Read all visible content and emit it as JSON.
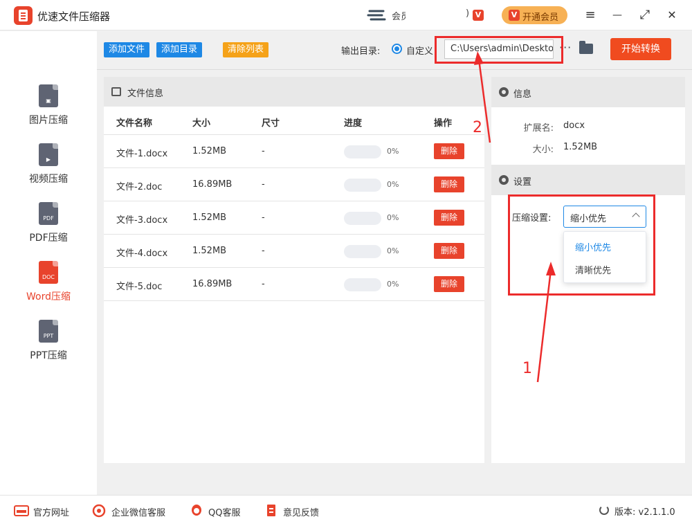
{
  "app": {
    "title": "优速文件压缩器",
    "center_text": "会员",
    "vip_label": "开通会员",
    "vip_badge": "V",
    "paren": ")"
  },
  "window_controls": {
    "menu": "≡",
    "minimize": "—",
    "maximize": "⤢",
    "close": "✕"
  },
  "sidebar": {
    "items": [
      {
        "label": "图片压缩",
        "glyph": "",
        "icon": "image-file-icon"
      },
      {
        "label": "视频压缩",
        "glyph": "▶",
        "icon": "video-file-icon"
      },
      {
        "label": "PDF压缩",
        "glyph": "PDF",
        "icon": "pdf-file-icon"
      },
      {
        "label": "Word压缩",
        "glyph": "DOC",
        "icon": "doc-file-icon",
        "active": true
      },
      {
        "label": "PPT压缩",
        "glyph": "PPT",
        "icon": "ppt-file-icon"
      }
    ]
  },
  "toolbar": {
    "add_file": "添加文件",
    "add_dir": "添加目录",
    "clear_list": "清除列表",
    "output_label": "输出目录:",
    "radio_label": "自定义",
    "output_path": "C:\\Users\\admin\\Desktop",
    "more": "···",
    "start": "开始转换"
  },
  "file_panel": {
    "title": "文件信息",
    "columns": [
      "文件名称",
      "大小",
      "尺寸",
      "进度",
      "操作"
    ],
    "rows": [
      {
        "name": "文件-1.docx",
        "size": "1.52MB",
        "dim": "-",
        "progress": "0%",
        "action": "删除"
      },
      {
        "name": "文件-2.doc",
        "size": "16.89MB",
        "dim": "-",
        "progress": "0%",
        "action": "删除"
      },
      {
        "name": "文件-3.docx",
        "size": "1.52MB",
        "dim": "-",
        "progress": "0%",
        "action": "删除"
      },
      {
        "name": "文件-4.docx",
        "size": "1.52MB",
        "dim": "-",
        "progress": "0%",
        "action": "删除"
      },
      {
        "name": "文件-5.doc",
        "size": "16.89MB",
        "dim": "-",
        "progress": "0%",
        "action": "删除"
      }
    ]
  },
  "info_panel": {
    "title": "信息",
    "ext_label": "扩展名:",
    "ext_value": "docx",
    "size_label": "大小:",
    "size_value": "1.52MB"
  },
  "settings_panel": {
    "title": "设置",
    "compress_label": "压缩设置:",
    "selected": "缩小优先",
    "options": [
      "缩小优先",
      "清晰优先"
    ]
  },
  "footer": {
    "website": "官方网址",
    "wechat": "企业微信客服",
    "qq": "QQ客服",
    "feedback": "意见反馈",
    "version": "版本: v2.1.1.0"
  },
  "annotations": {
    "one": "1",
    "two": "2"
  },
  "colors": {
    "brand": "#e8432c",
    "primary": "#1e88e5",
    "annotation": "#ec2b2b",
    "vip": "#f7b155"
  }
}
